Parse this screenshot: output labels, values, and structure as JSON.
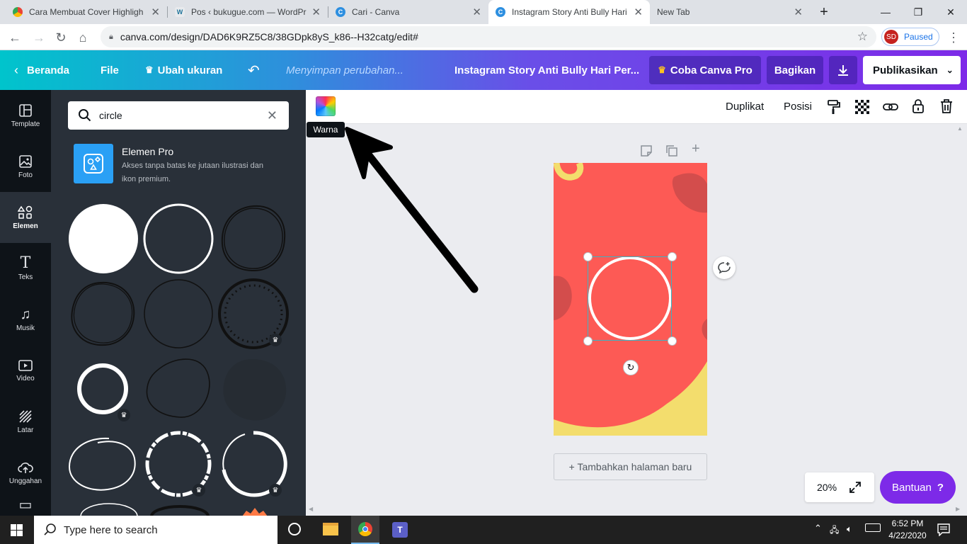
{
  "browser": {
    "tabs": [
      {
        "title": "Cara Membuat Cover Highligh",
        "favicon": "chrome-icon"
      },
      {
        "title": "Pos ‹ bukugue.com — WordPr",
        "favicon": "wordpress-icon"
      },
      {
        "title": "Cari - Canva",
        "favicon": "canva-icon"
      },
      {
        "title": "Instagram Story Anti Bully Hari",
        "favicon": "canva-icon"
      },
      {
        "title": "New Tab",
        "favicon": ""
      }
    ],
    "url": "canva.com/design/DAD6K9RZ5C8/38GDpk8yS_k86--H32catg/edit#",
    "profile_initials": "SD",
    "profile_status": "Paused"
  },
  "header": {
    "home": "Beranda",
    "file": "File",
    "resize": "Ubah ukuran",
    "saving": "Menyimpan perubahan...",
    "doc_title": "Instagram Story Anti Bully Hari Per...",
    "try_pro": "Coba Canva Pro",
    "share": "Bagikan",
    "publish": "Publikasikan"
  },
  "rail": [
    {
      "label": "Template",
      "icon": "template-icon"
    },
    {
      "label": "Foto",
      "icon": "photo-icon"
    },
    {
      "label": "Elemen",
      "icon": "elements-icon"
    },
    {
      "label": "Teks",
      "icon": "text-icon"
    },
    {
      "label": "Musik",
      "icon": "music-icon"
    },
    {
      "label": "Video",
      "icon": "video-icon"
    },
    {
      "label": "Latar",
      "icon": "background-icon"
    },
    {
      "label": "Unggahan",
      "icon": "upload-icon"
    }
  ],
  "panel": {
    "search_value": "circle",
    "pro_title": "Elemen Pro",
    "pro_desc_1": "Akses tanpa batas ke jutaan ilustrasi dan",
    "pro_desc_2": "ikon premium."
  },
  "toolbar": {
    "color_tooltip": "Warna",
    "duplicate": "Duplikat",
    "position": "Posisi"
  },
  "canvas": {
    "add_page": "+ Tambahkan halaman baru",
    "zoom": "20%",
    "help": "Bantuan",
    "colors": {
      "page": "#fd5a55",
      "accent": "#f3dd6d",
      "selection": "#3bb3c3"
    }
  },
  "taskbar": {
    "search_placeholder": "Type here to search",
    "time": "6:52 PM",
    "date": "4/22/2020"
  }
}
